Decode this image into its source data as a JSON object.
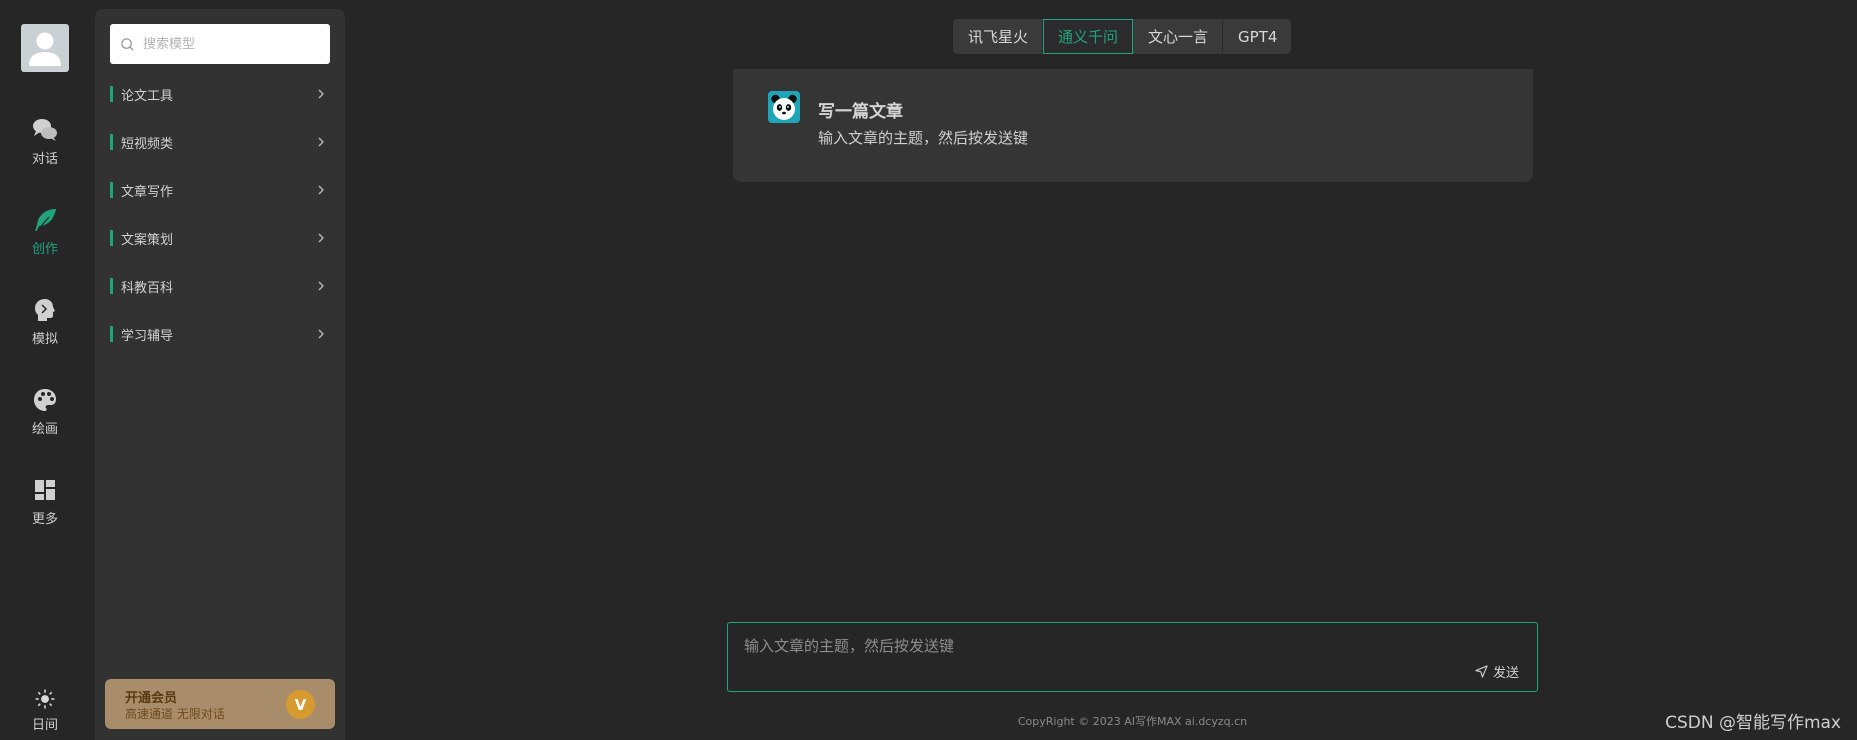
{
  "rail": {
    "items": [
      {
        "label": "对话",
        "icon": "chat-bubbles-icon"
      },
      {
        "label": "创作",
        "icon": "feather-icon",
        "active": true
      },
      {
        "label": "模拟",
        "icon": "head-silhouette-icon"
      },
      {
        "label": "绘画",
        "icon": "palette-icon"
      },
      {
        "label": "更多",
        "icon": "grid-icon"
      },
      {
        "label": "日间",
        "icon": "sun-icon"
      }
    ]
  },
  "sidebar": {
    "search_placeholder": "搜索模型",
    "categories": [
      {
        "label": "论文工具"
      },
      {
        "label": "短视频类"
      },
      {
        "label": "文章写作"
      },
      {
        "label": "文案策划"
      },
      {
        "label": "科教百科"
      },
      {
        "label": "学习辅导"
      }
    ],
    "vip": {
      "title": "开通会员",
      "subtitle": "高速通道 无限对话",
      "badge": "V"
    }
  },
  "model_tabs": {
    "items": [
      {
        "label": "讯飞星火"
      },
      {
        "label": "通义千问",
        "active": true
      },
      {
        "label": "文心一言"
      },
      {
        "label": "GPT4"
      }
    ]
  },
  "intro": {
    "title": "写一篇文章",
    "description": "输入文章的主题，然后按发送键"
  },
  "composer": {
    "placeholder": "输入文章的主题，然后按发送键",
    "send_label": "发送"
  },
  "footer": {
    "copyright": "CopyRight © 2023 AI写作MAX ai.dcyzq.cn"
  },
  "watermark": "CSDN @智能写作max",
  "colors": {
    "accent": "#20a47e",
    "background": "#262626",
    "panel": "#323232",
    "vip": "#a98d6b"
  }
}
